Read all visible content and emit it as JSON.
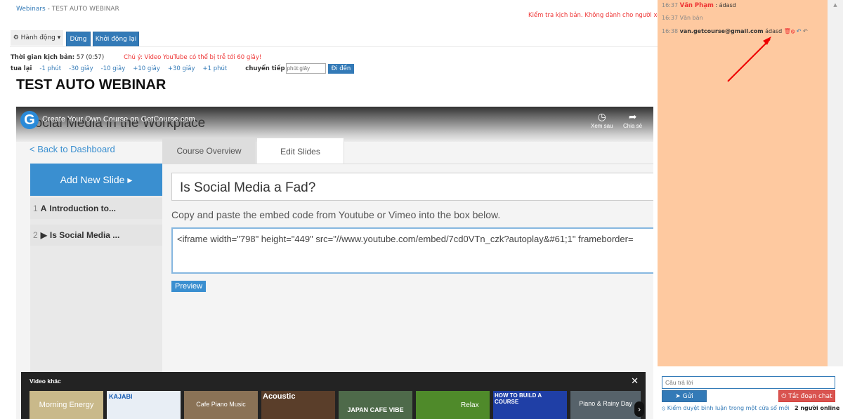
{
  "breadcrumb": {
    "root": "Webinars",
    "sep": " - ",
    "current": "TEST AUTO WEBINAR"
  },
  "warning": "Kiểm tra kịch bản. Không dành cho người xem.",
  "toolbar": {
    "actions": "Hành động",
    "stop": "Dừng",
    "restart": "Khởi động lại"
  },
  "script_time": {
    "label": "Thời gian kịch bản:",
    "value": "57 (0:57)",
    "note": "Chú ý: Video YouTube có thể bị trễ tới 60 giây!"
  },
  "rewind": {
    "label": "tua lại",
    "steps": [
      "-1 phút",
      "-30 giây",
      "-10 giây",
      "+10 giây",
      "+30 giây",
      "+1 phút"
    ],
    "forward_label": "chuyển tiếp",
    "input_placeholder": "phút:giây",
    "go": "Đi đến"
  },
  "page_title": "TEST AUTO WEBINAR",
  "video": {
    "channel_title": "Create Your Own Course on GetCourse.com",
    "bg_title": "Social Media in the Workplace",
    "watch_later": "Xem sau",
    "share": "Chia sẻ",
    "back": "< Back to Dashboard",
    "tab1": "Course Overview",
    "tab2": "Edit Slides",
    "add_slide": "Add New Slide ▸",
    "slides": [
      {
        "num": "1",
        "title": "Introduction to..."
      },
      {
        "num": "2",
        "title": "Is Social Media ..."
      }
    ],
    "slide_title": "Is Social Media a Fad?",
    "instructions": "Copy and paste the embed code from Youtube or Vimeo into the box below.",
    "embed": "<iframe width=\"798\" height=\"449\" src=\"//www.youtube.com/embed/7cd0VTn_czk?autoplay&#61;1\" frameborder=",
    "preview": "Preview",
    "more_label": "Video khác",
    "thumbs": [
      "Morning Energy",
      "KAJABI",
      "Cafe Piano Music",
      "Acoustic",
      "JAPAN CAFE VIBE",
      "Relax",
      "HOW TO BUILD A COURSE",
      "Piano & Rainy Day"
    ]
  },
  "chat": {
    "messages": [
      {
        "time": "16:37",
        "author": "Văn Phạm",
        "text": ": ádasd"
      },
      {
        "time": "16:37",
        "text": "Văn bản"
      },
      {
        "time": "16:38",
        "author": "van.getcourse@gmail.com",
        "text": "ádasd"
      }
    ],
    "reply_placeholder": "Câu trả lời",
    "send": "Gửi",
    "close_chat": "Tắt đoạn chat",
    "moderate": "Kiểm duyệt bình luận trong một cửa sổ mới",
    "online": "2 người online"
  },
  "colors": {
    "primary": "#337ab7",
    "danger": "#d9534f",
    "chat_bg": "#fec9a0"
  }
}
